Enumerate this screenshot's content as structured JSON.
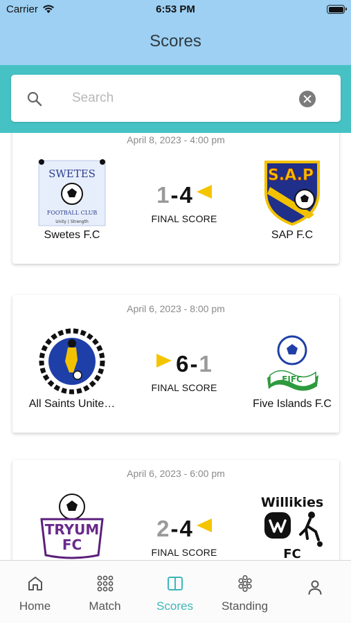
{
  "status_bar": {
    "carrier": "Carrier",
    "time": "6:53 PM"
  },
  "header": {
    "title": "Scores"
  },
  "search": {
    "placeholder": "Search",
    "value": ""
  },
  "matches": [
    {
      "date": "April 8, 2023 - 4:00 pm",
      "home": {
        "name": "Swetes F.C",
        "score": "1",
        "logo_text": [
          "SWETES",
          "FOOTBALL CLUB",
          "Unity | Strength"
        ]
      },
      "away": {
        "name": "SAP F.C",
        "score": "4",
        "logo_text": [
          "S.A.P"
        ]
      },
      "winner": "away",
      "status": "FINAL SCORE"
    },
    {
      "date": "April 6, 2023 - 8:00 pm",
      "home": {
        "name": "All Saints Unite…",
        "score": "6",
        "logo_text": []
      },
      "away": {
        "name": "Five Islands F.C",
        "score": "1",
        "logo_text": [
          "FIFC"
        ]
      },
      "winner": "home",
      "status": "FINAL SCORE"
    },
    {
      "date": "April 6, 2023 - 6:00 pm",
      "home": {
        "name": "",
        "score": "2",
        "logo_text": [
          "TRYUM",
          "FC"
        ]
      },
      "away": {
        "name": "",
        "score": "4",
        "logo_text": [
          "Willikies",
          "FC"
        ]
      },
      "winner": "away",
      "status": "FINAL SCORE"
    }
  ],
  "tabs": [
    {
      "label": "Home",
      "icon": "home-icon"
    },
    {
      "label": "Match",
      "icon": "grid-dots-icon"
    },
    {
      "label": "Scores",
      "icon": "book-icon",
      "active": true
    },
    {
      "label": "Standing",
      "icon": "cluster-icon"
    },
    {
      "label": "",
      "icon": "person-icon"
    }
  ],
  "colors": {
    "header": "#9dd0f3",
    "search_band": "#46c2c5",
    "accent": "#3fb6b9",
    "win_arrow": "#f5c400"
  }
}
